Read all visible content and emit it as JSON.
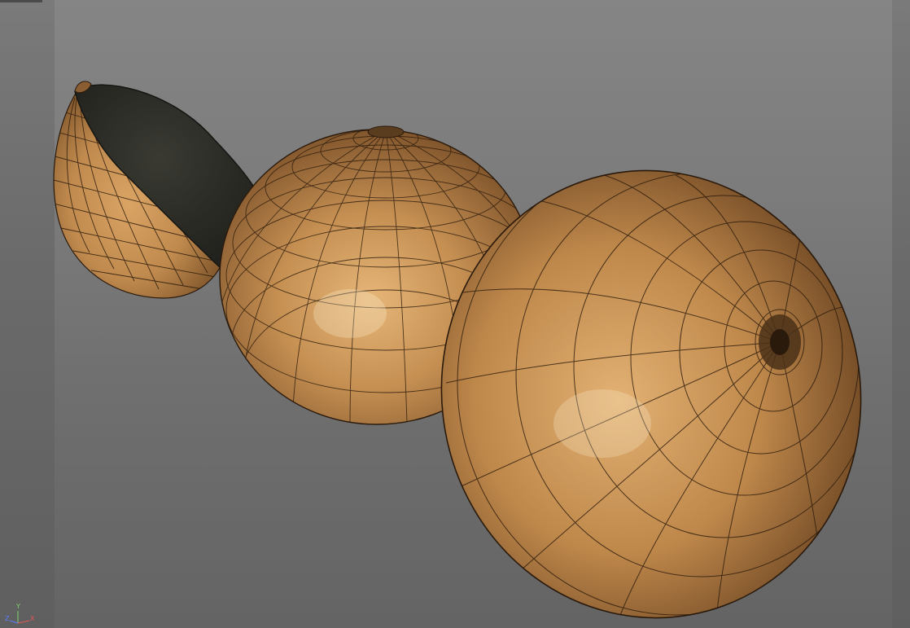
{
  "viewport": {
    "background_top": "#858585",
    "background_bottom": "#646464",
    "mesh_color": "#c08a4e",
    "wire_color": "#2a1a0c",
    "cut_face_color": "#2b2b26"
  },
  "scene": {
    "objects": [
      {
        "name": "half-fruit",
        "kind": "cut-half"
      },
      {
        "name": "middle-fruit",
        "kind": "whole"
      },
      {
        "name": "front-fruit",
        "kind": "whole"
      }
    ]
  },
  "axis_gizmo": {
    "y_label": "Y",
    "x_label": "X",
    "z_label": "Z",
    "y_color": "#7cd66a",
    "x_color": "#e25555",
    "z_color": "#5a7cff"
  }
}
